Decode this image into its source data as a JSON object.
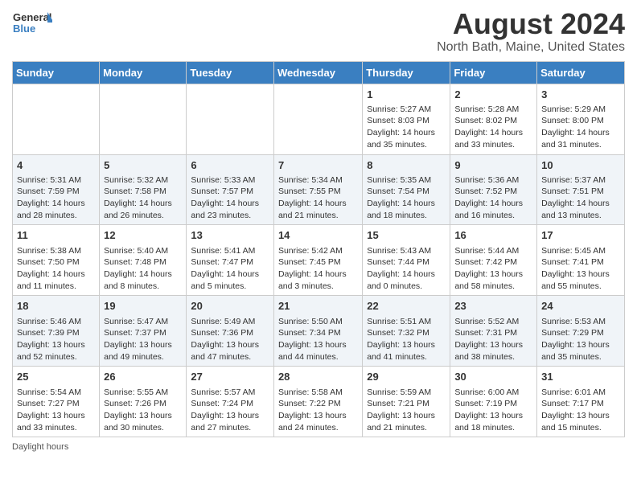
{
  "header": {
    "logo_general": "General",
    "logo_blue": "Blue",
    "title": "August 2024",
    "subtitle": "North Bath, Maine, United States"
  },
  "weekdays": [
    "Sunday",
    "Monday",
    "Tuesday",
    "Wednesday",
    "Thursday",
    "Friday",
    "Saturday"
  ],
  "weeks": [
    [
      {
        "day": "",
        "content": ""
      },
      {
        "day": "",
        "content": ""
      },
      {
        "day": "",
        "content": ""
      },
      {
        "day": "",
        "content": ""
      },
      {
        "day": "1",
        "content": "Sunrise: 5:27 AM\nSunset: 8:03 PM\nDaylight: 14 hours and 35 minutes."
      },
      {
        "day": "2",
        "content": "Sunrise: 5:28 AM\nSunset: 8:02 PM\nDaylight: 14 hours and 33 minutes."
      },
      {
        "day": "3",
        "content": "Sunrise: 5:29 AM\nSunset: 8:00 PM\nDaylight: 14 hours and 31 minutes."
      }
    ],
    [
      {
        "day": "4",
        "content": "Sunrise: 5:31 AM\nSunset: 7:59 PM\nDaylight: 14 hours and 28 minutes."
      },
      {
        "day": "5",
        "content": "Sunrise: 5:32 AM\nSunset: 7:58 PM\nDaylight: 14 hours and 26 minutes."
      },
      {
        "day": "6",
        "content": "Sunrise: 5:33 AM\nSunset: 7:57 PM\nDaylight: 14 hours and 23 minutes."
      },
      {
        "day": "7",
        "content": "Sunrise: 5:34 AM\nSunset: 7:55 PM\nDaylight: 14 hours and 21 minutes."
      },
      {
        "day": "8",
        "content": "Sunrise: 5:35 AM\nSunset: 7:54 PM\nDaylight: 14 hours and 18 minutes."
      },
      {
        "day": "9",
        "content": "Sunrise: 5:36 AM\nSunset: 7:52 PM\nDaylight: 14 hours and 16 minutes."
      },
      {
        "day": "10",
        "content": "Sunrise: 5:37 AM\nSunset: 7:51 PM\nDaylight: 14 hours and 13 minutes."
      }
    ],
    [
      {
        "day": "11",
        "content": "Sunrise: 5:38 AM\nSunset: 7:50 PM\nDaylight: 14 hours and 11 minutes."
      },
      {
        "day": "12",
        "content": "Sunrise: 5:40 AM\nSunset: 7:48 PM\nDaylight: 14 hours and 8 minutes."
      },
      {
        "day": "13",
        "content": "Sunrise: 5:41 AM\nSunset: 7:47 PM\nDaylight: 14 hours and 5 minutes."
      },
      {
        "day": "14",
        "content": "Sunrise: 5:42 AM\nSunset: 7:45 PM\nDaylight: 14 hours and 3 minutes."
      },
      {
        "day": "15",
        "content": "Sunrise: 5:43 AM\nSunset: 7:44 PM\nDaylight: 14 hours and 0 minutes."
      },
      {
        "day": "16",
        "content": "Sunrise: 5:44 AM\nSunset: 7:42 PM\nDaylight: 13 hours and 58 minutes."
      },
      {
        "day": "17",
        "content": "Sunrise: 5:45 AM\nSunset: 7:41 PM\nDaylight: 13 hours and 55 minutes."
      }
    ],
    [
      {
        "day": "18",
        "content": "Sunrise: 5:46 AM\nSunset: 7:39 PM\nDaylight: 13 hours and 52 minutes."
      },
      {
        "day": "19",
        "content": "Sunrise: 5:47 AM\nSunset: 7:37 PM\nDaylight: 13 hours and 49 minutes."
      },
      {
        "day": "20",
        "content": "Sunrise: 5:49 AM\nSunset: 7:36 PM\nDaylight: 13 hours and 47 minutes."
      },
      {
        "day": "21",
        "content": "Sunrise: 5:50 AM\nSunset: 7:34 PM\nDaylight: 13 hours and 44 minutes."
      },
      {
        "day": "22",
        "content": "Sunrise: 5:51 AM\nSunset: 7:32 PM\nDaylight: 13 hours and 41 minutes."
      },
      {
        "day": "23",
        "content": "Sunrise: 5:52 AM\nSunset: 7:31 PM\nDaylight: 13 hours and 38 minutes."
      },
      {
        "day": "24",
        "content": "Sunrise: 5:53 AM\nSunset: 7:29 PM\nDaylight: 13 hours and 35 minutes."
      }
    ],
    [
      {
        "day": "25",
        "content": "Sunrise: 5:54 AM\nSunset: 7:27 PM\nDaylight: 13 hours and 33 minutes."
      },
      {
        "day": "26",
        "content": "Sunrise: 5:55 AM\nSunset: 7:26 PM\nDaylight: 13 hours and 30 minutes."
      },
      {
        "day": "27",
        "content": "Sunrise: 5:57 AM\nSunset: 7:24 PM\nDaylight: 13 hours and 27 minutes."
      },
      {
        "day": "28",
        "content": "Sunrise: 5:58 AM\nSunset: 7:22 PM\nDaylight: 13 hours and 24 minutes."
      },
      {
        "day": "29",
        "content": "Sunrise: 5:59 AM\nSunset: 7:21 PM\nDaylight: 13 hours and 21 minutes."
      },
      {
        "day": "30",
        "content": "Sunrise: 6:00 AM\nSunset: 7:19 PM\nDaylight: 13 hours and 18 minutes."
      },
      {
        "day": "31",
        "content": "Sunrise: 6:01 AM\nSunset: 7:17 PM\nDaylight: 13 hours and 15 minutes."
      }
    ]
  ],
  "footer": {
    "daylight_label": "Daylight hours"
  }
}
